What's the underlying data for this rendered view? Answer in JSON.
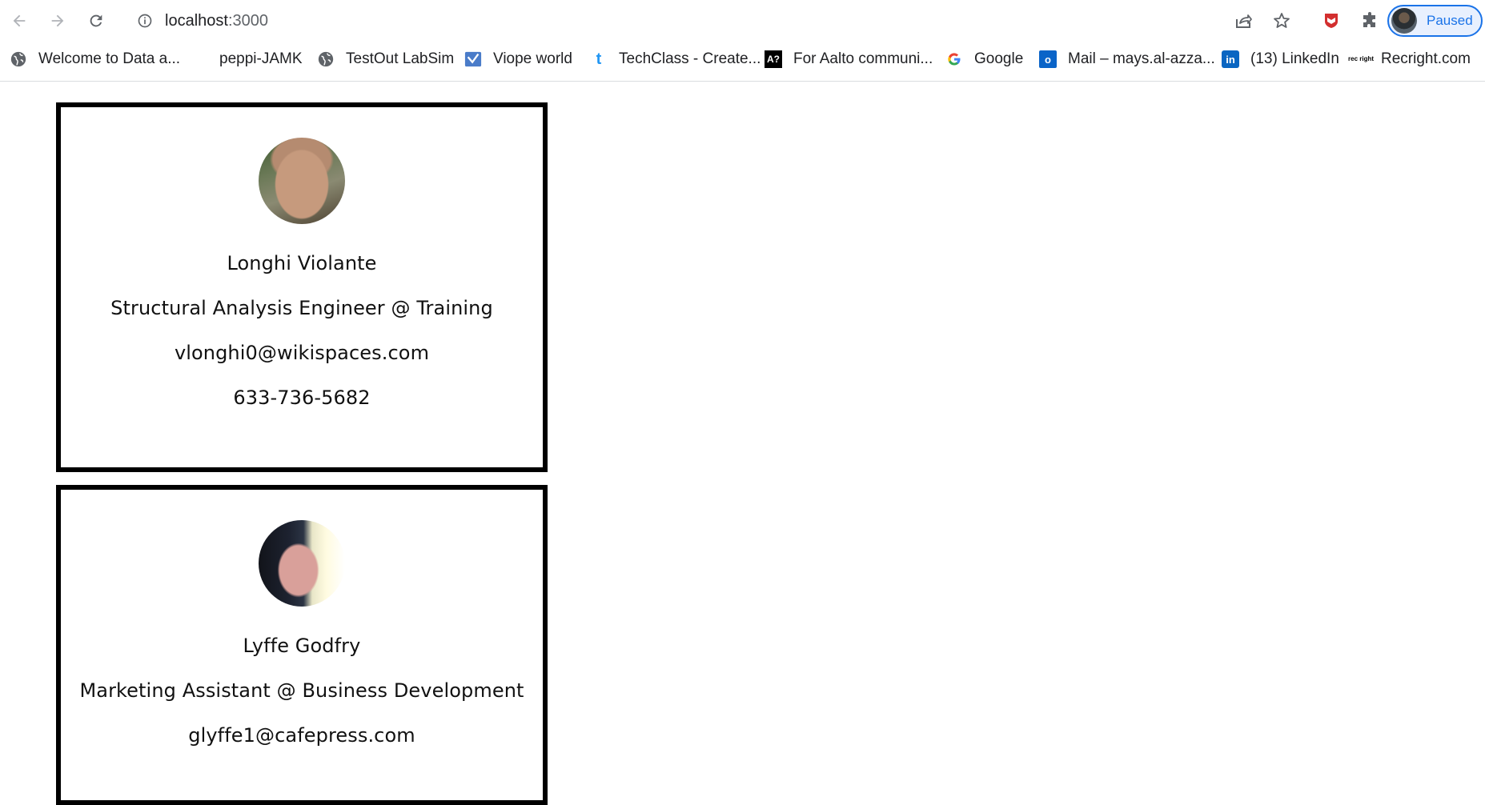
{
  "browser": {
    "url_host": "localhost",
    "url_port": ":3000",
    "profile_status": "Paused",
    "bookmarks": [
      {
        "label": "Welcome to Data a...",
        "icon": "globe-icon"
      },
      {
        "label": "peppi-JAMK",
        "icon": ""
      },
      {
        "label": "TestOut LabSim",
        "icon": "globe-icon"
      },
      {
        "label": "Viope world",
        "icon": "viope-icon"
      },
      {
        "label": "TechClass - Create...",
        "icon": "techclass-icon"
      },
      {
        "label": "For Aalto communi...",
        "icon": "aalto-icon"
      },
      {
        "label": "Google",
        "icon": "google-icon"
      },
      {
        "label": "Mail – mays.al-azza...",
        "icon": "outlook-icon"
      },
      {
        "label": "(13) LinkedIn",
        "icon": "linkedin-icon"
      },
      {
        "label": "Recright.com",
        "icon": "recright-icon"
      }
    ],
    "icon_texts": {
      "aalto": "A?",
      "techclass": "t",
      "linkedin": "in",
      "outlook": "o",
      "recright": "rec right"
    },
    "colors": {
      "accent": "#1a73e8",
      "shield": "#d32f2f"
    }
  },
  "cards": [
    {
      "name": "Longhi Violante",
      "title": "Structural Analysis Engineer @ Training",
      "email": "vlonghi0@wikispaces.com",
      "phone": "633-736-5682"
    },
    {
      "name": "Lyffe Godfry",
      "title": "Marketing Assistant @ Business Development",
      "email": "glyffe1@cafepress.com"
    }
  ]
}
